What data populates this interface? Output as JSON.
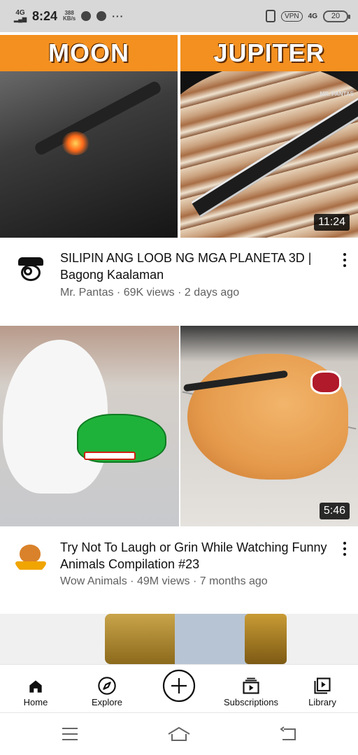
{
  "status_bar": {
    "network": "4G",
    "time": "8:24",
    "speed_value": "388",
    "speed_unit": "KB/s",
    "more": "···",
    "vpn": "VPN",
    "network_right": "4G",
    "battery": "20"
  },
  "videos": [
    {
      "thumbnail_label_left": "MOON",
      "thumbnail_label_right": "JUPITER",
      "watermark": "MR. PANTAS",
      "duration": "11:24",
      "title": "SILIPIN ANG LOOB NG MGA PLANETA 3D | Bagong Kaalaman",
      "channel": "Mr. Pantas",
      "views": "69K views",
      "age": "2 days ago",
      "separator": " · "
    },
    {
      "duration": "5:46",
      "title": "Try Not To Laugh or Grin While Watching Funny Animals Compilation #23",
      "channel": "Wow Animals",
      "views": "49M views",
      "age": "7 months ago",
      "separator": " · ",
      "avatar_logo": "Wow Animals"
    }
  ],
  "bottom_nav": {
    "home": "Home",
    "explore": "Explore",
    "subscriptions": "Subscriptions",
    "library": "Library"
  },
  "colors": {
    "label_band": "#f3901f",
    "secondary_text": "#606060"
  }
}
